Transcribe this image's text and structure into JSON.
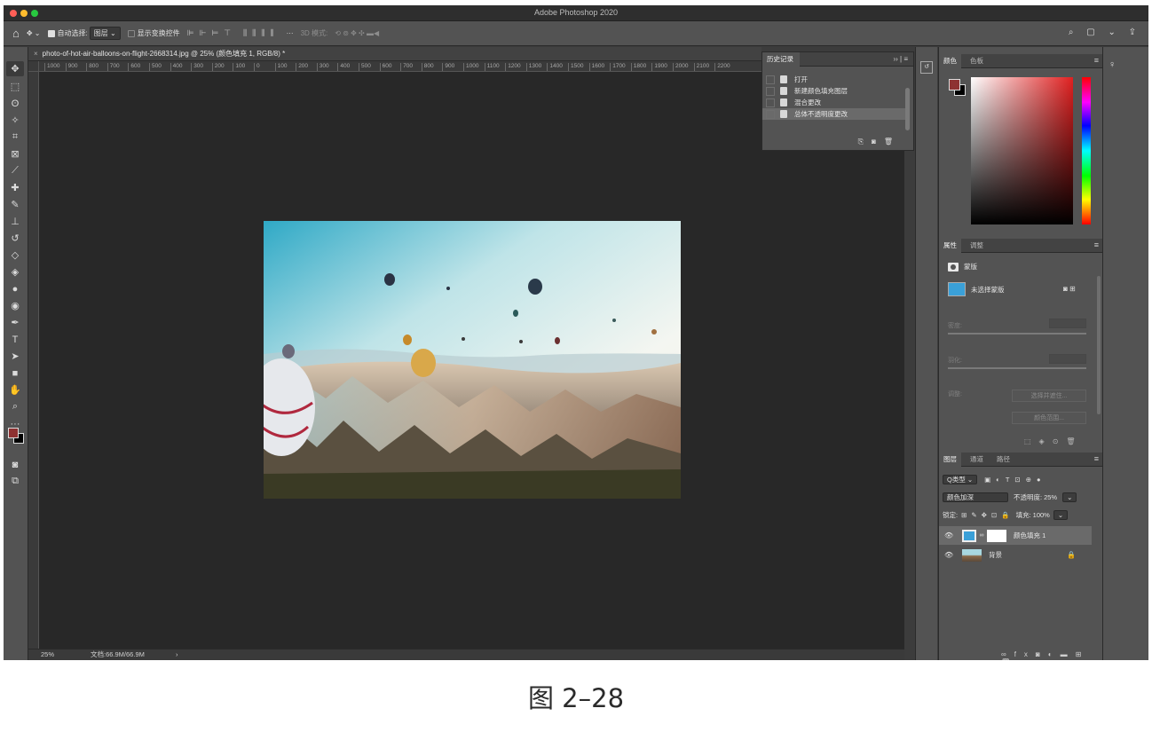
{
  "app": {
    "title": "Adobe Photoshop 2020"
  },
  "options_bar": {
    "auto_select_label": "自动选择:",
    "auto_select_value": "图层",
    "show_transform_label": "显示变换控件",
    "more": "···",
    "mode_3d": "3D 模式:"
  },
  "document": {
    "tab_title": "photo-of-hot-air-balloons-on-flight-2668314.jpg @ 25% (颜色填充 1, RGB/8) *",
    "ruler_ticks": [
      "1000",
      "900",
      "800",
      "700",
      "600",
      "500",
      "400",
      "300",
      "200",
      "100",
      "0",
      "100",
      "200",
      "300",
      "400",
      "500",
      "600",
      "700",
      "800",
      "900",
      "1000",
      "1100",
      "1200",
      "1300",
      "1400",
      "1500",
      "1600",
      "1700",
      "1800",
      "1900",
      "2000",
      "2100",
      "2200"
    ]
  },
  "status_bar": {
    "zoom": "25%",
    "doc_info": "文档:66.9M/66.9M",
    "arrow": "›"
  },
  "history_panel": {
    "tab": "历史记录",
    "controls": "›› | ≡",
    "items": [
      {
        "label": "打开",
        "selected": false
      },
      {
        "label": "新建颜色填充图层",
        "selected": false
      },
      {
        "label": "混合更改",
        "selected": false
      },
      {
        "label": "总体不透明度更改",
        "selected": true
      }
    ]
  },
  "color_panel": {
    "tabs": [
      "颜色",
      "色板"
    ],
    "foreground": "#8e3232",
    "background": "#000000"
  },
  "properties_panel": {
    "tabs": [
      "属性",
      "调整"
    ],
    "section": "蒙版",
    "mask_name": "未选择蒙版",
    "density_label": "密度:",
    "feather_label": "羽化:",
    "refine_label": "调整:",
    "select_mask_button": "选择并遮住...",
    "color_range_button": "颜色范围..."
  },
  "layers_panel": {
    "tabs": [
      "图层",
      "通道",
      "路径"
    ],
    "filter_type": "Q类型",
    "blend_mode": "颜色加深",
    "opacity_label": "不透明度:",
    "opacity_value": "25%",
    "lock_label": "锁定:",
    "fill_label": "填充:",
    "fill_value": "100%",
    "layers": [
      {
        "name": "颜色填充 1",
        "selected": true
      },
      {
        "name": "背景",
        "selected": false
      }
    ]
  },
  "caption": "图 2–28",
  "colors": {
    "accent": "#3aa0d8",
    "ui_bg": "#535353",
    "canvas": "#282828"
  }
}
